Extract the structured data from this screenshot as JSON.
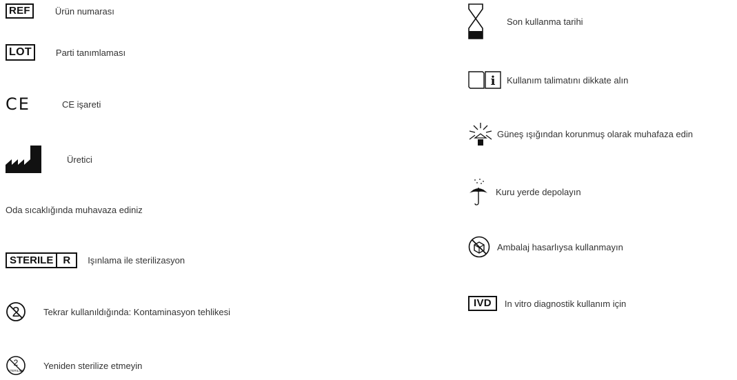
{
  "left": {
    "ref": {
      "badge": "REF",
      "text": "Ürün numarası"
    },
    "lot": {
      "badge": "LOT",
      "text": "Parti tanımlaması"
    },
    "ce": {
      "symbol": "CE",
      "text": "CE işareti"
    },
    "manufacturer": {
      "text": "Üretici"
    },
    "room_temp": {
      "text": "Oda sıcaklığında muhavaza ediniz"
    },
    "sterile": {
      "badge_left": "STERILE",
      "badge_right": "R",
      "text": "Işınlama ile sterilizasyon"
    },
    "no_reuse": {
      "text": "Tekrar kullanıldığında: Kontaminasyon tehlikesi"
    },
    "no_resterilize": {
      "text": "Yeniden sterilize etmeyin",
      "icon_text": "STERILIZE"
    }
  },
  "right": {
    "expiry": {
      "text": "Son kullanma tarihi"
    },
    "ifu": {
      "text": "Kullanım talimatını dikkate alın"
    },
    "sunlight": {
      "text": "Güneş ışığından korunmuş olarak muhafaza edin"
    },
    "dry": {
      "text": "Kuru yerde depolayın"
    },
    "damaged": {
      "text": "Ambalaj hasarlıysa kullanmayın"
    },
    "ivd": {
      "badge": "IVD",
      "text": "In vitro diagnostik kullanım için"
    }
  },
  "icons": {
    "manufacturer": "factory-icon",
    "expiry": "hourglass-icon",
    "ifu": "instructions-book-icon",
    "sunlight": "sunlight-icon",
    "dry": "umbrella-icon",
    "damaged": "damaged-package-icon",
    "no_reuse": "no-reuse-icon",
    "no_resterilize": "no-resterilize-icon"
  }
}
